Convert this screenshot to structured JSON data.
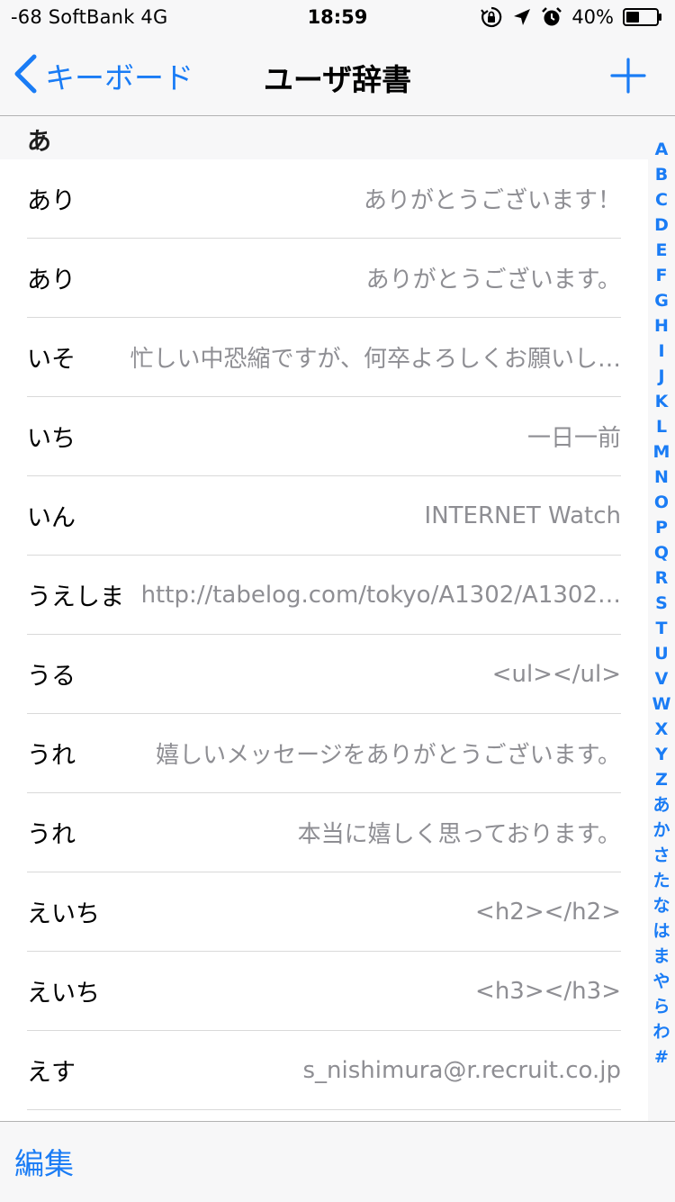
{
  "status_bar": {
    "carrier": "-68 SoftBank   4G",
    "time": "18:59",
    "battery": "40%",
    "icons": [
      "orientation-lock-icon",
      "location-arrow-icon",
      "alarm-clock-icon",
      "battery-icon"
    ]
  },
  "nav": {
    "back_label": "キーボード",
    "title": "ユーザ辞書",
    "add_icon": "plus-icon"
  },
  "list": {
    "section_title": "あ",
    "rows": [
      {
        "reading": "あり",
        "word": "ありがとうございます！"
      },
      {
        "reading": "あり",
        "word": "ありがとうございます。"
      },
      {
        "reading": "いそ",
        "word": "忙しい中恐縮ですが、何卒よろしくお願いし…"
      },
      {
        "reading": "いち",
        "word": "一日一前"
      },
      {
        "reading": "いん",
        "word": "INTERNET Watch"
      },
      {
        "reading": "うえしま",
        "word": "http://tabelog.com/tokyo/A1302/A1302…"
      },
      {
        "reading": "うる",
        "word": "<ul></ul>"
      },
      {
        "reading": "うれ",
        "word": "嬉しいメッセージをありがとうございます。"
      },
      {
        "reading": "うれ",
        "word": "本当に嬉しく思っております。"
      },
      {
        "reading": "えいち",
        "word": "<h2></h2>"
      },
      {
        "reading": "えいち",
        "word": "<h3></h3>"
      },
      {
        "reading": "えす",
        "word": "s_nishimura@r.recruit.co.jp"
      }
    ]
  },
  "section_index": [
    "A",
    "B",
    "C",
    "D",
    "E",
    "F",
    "G",
    "H",
    "I",
    "J",
    "K",
    "L",
    "M",
    "N",
    "O",
    "P",
    "Q",
    "R",
    "S",
    "T",
    "U",
    "V",
    "W",
    "X",
    "Y",
    "Z",
    "あ",
    "か",
    "さ",
    "た",
    "な",
    "は",
    "ま",
    "や",
    "ら",
    "わ",
    "#"
  ],
  "toolbar": {
    "edit_label": "編集"
  },
  "colors": {
    "accent": "#1a7cf5",
    "secondary_text": "#8e8e93",
    "bar_background": "#f7f7f8"
  }
}
